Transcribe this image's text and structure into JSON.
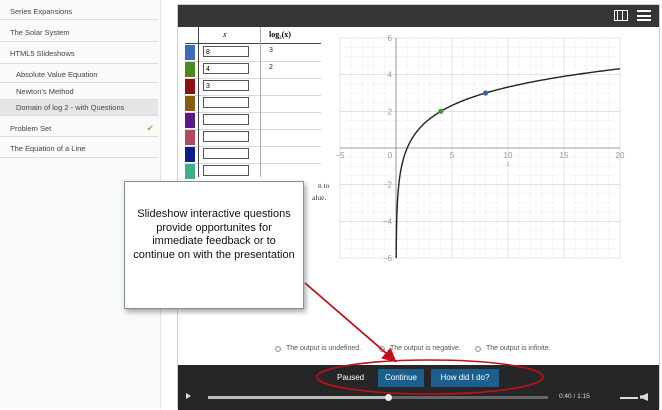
{
  "sidebar": {
    "items": [
      {
        "label": "Series Expansions"
      },
      {
        "label": "The Solar System"
      },
      {
        "label": "HTML5 Slideshows"
      },
      {
        "label": "Absolute Value Equation"
      },
      {
        "label": "Newton's Method"
      },
      {
        "label": "Domain of log 2 - with Questions"
      },
      {
        "label": "Problem Set",
        "check": "✔"
      },
      {
        "label": "The Equation of a Line"
      }
    ]
  },
  "table": {
    "header_x": "x",
    "header_y": "log₂(x)",
    "rows": [
      {
        "x": "8",
        "y": "3",
        "color": "#3d6bb5"
      },
      {
        "x": "4",
        "y": "2",
        "color": "#4d8a1e"
      },
      {
        "x": "3",
        "y": "",
        "color": "#8c0f14"
      },
      {
        "x": "",
        "y": "",
        "color": "#8a5a10"
      },
      {
        "x": "",
        "y": "",
        "color": "#5a1a86"
      },
      {
        "x": "",
        "y": "",
        "color": "#b04a5c"
      },
      {
        "x": "",
        "y": "",
        "color": "#101a8a"
      },
      {
        "x": "",
        "y": "",
        "color": "#3fae8a"
      }
    ]
  },
  "hidden_text": {
    "line1": "n to",
    "line2": "alue."
  },
  "chart_data": {
    "type": "line",
    "function": "log2(x)",
    "xlim": [
      -5,
      20
    ],
    "ylim": [
      -6,
      6
    ],
    "xticks": [
      "−5",
      "0",
      "5",
      "10",
      "15",
      "20"
    ],
    "yticks": [
      "6",
      "4",
      "2",
      "0",
      "−2",
      "−4",
      "−6"
    ],
    "xlabel": "x",
    "grid": true,
    "points": [
      {
        "x": 4,
        "y": 2,
        "color": "#3a9a2a"
      },
      {
        "x": 8,
        "y": 3,
        "color": "#3d5fb0"
      }
    ],
    "curve_color": "#222222"
  },
  "question": {
    "options": [
      "The output is undefined.",
      "The output is negative.",
      "The output is infinite."
    ]
  },
  "controls": {
    "status": "Paused",
    "continue_label": "Continue",
    "check_label": "How did I do?",
    "time": "0:40 / 1:15",
    "progress": 0.53
  },
  "callout": {
    "text": "Slideshow interactive questions provide opportunites for immediate feedback or to continue on with the presentation"
  },
  "colors": {
    "annotation": "#c0111a",
    "button": "#1b5f8f"
  }
}
